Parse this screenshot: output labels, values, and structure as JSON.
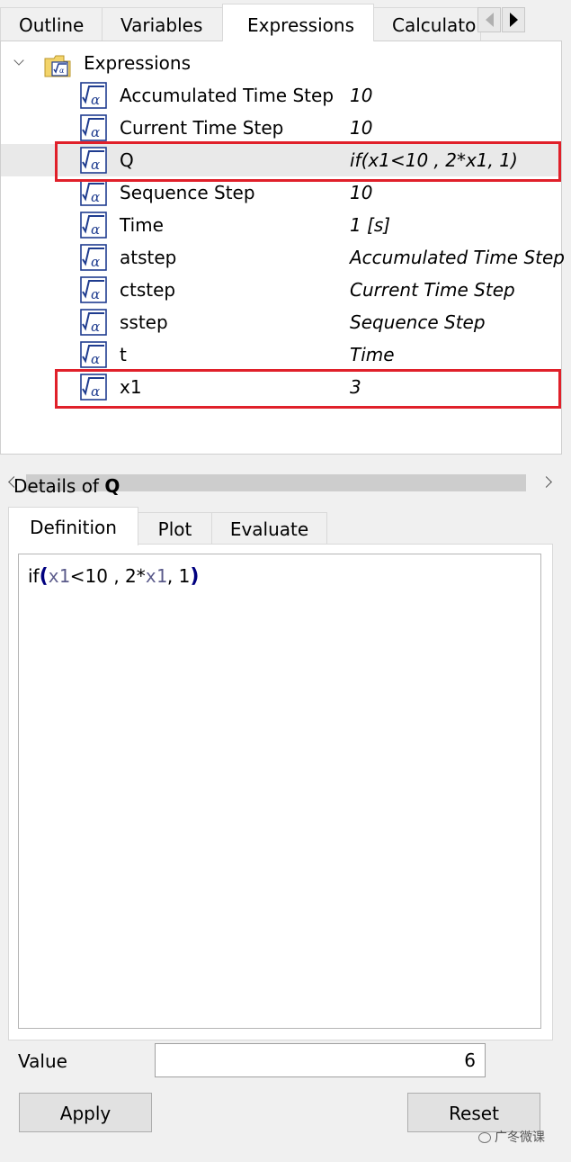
{
  "top_tabs": {
    "outline": "Outline",
    "variables": "Variables",
    "expressions": "Expressions",
    "calculator": "Calculator"
  },
  "tree": {
    "root": "Expressions",
    "rows": [
      {
        "name": "Accumulated Time Step",
        "value": "10"
      },
      {
        "name": "Current Time Step",
        "value": "10"
      },
      {
        "name": "Q",
        "value": "if(x1<10 , 2*x1, 1)"
      },
      {
        "name": "Sequence Step",
        "value": "10"
      },
      {
        "name": "Time",
        "value": "1 [s]"
      },
      {
        "name": "atstep",
        "value": "Accumulated Time Step"
      },
      {
        "name": "ctstep",
        "value": "Current Time Step"
      },
      {
        "name": "sstep",
        "value": "Sequence Step"
      },
      {
        "name": "t",
        "value": "Time"
      },
      {
        "name": "x1",
        "value": "3"
      }
    ]
  },
  "details": {
    "prefix": "Details of",
    "item": "Q",
    "tabs": {
      "definition": "Definition",
      "plot": "Plot",
      "evaluate": "Evaluate"
    },
    "definition": {
      "fn": "if",
      "open": "(",
      "var1": "x1",
      "part1": "<10 , 2*",
      "var2": "x1",
      "part2": ", 1",
      "close": ")"
    },
    "value_label": "Value",
    "value": "6",
    "apply": "Apply",
    "reset": "Reset"
  },
  "watermark": "广冬微课",
  "colors": {
    "highlight": "#e0202a",
    "bracket": "#00007f",
    "icon_blue": "#1f3c8f"
  }
}
